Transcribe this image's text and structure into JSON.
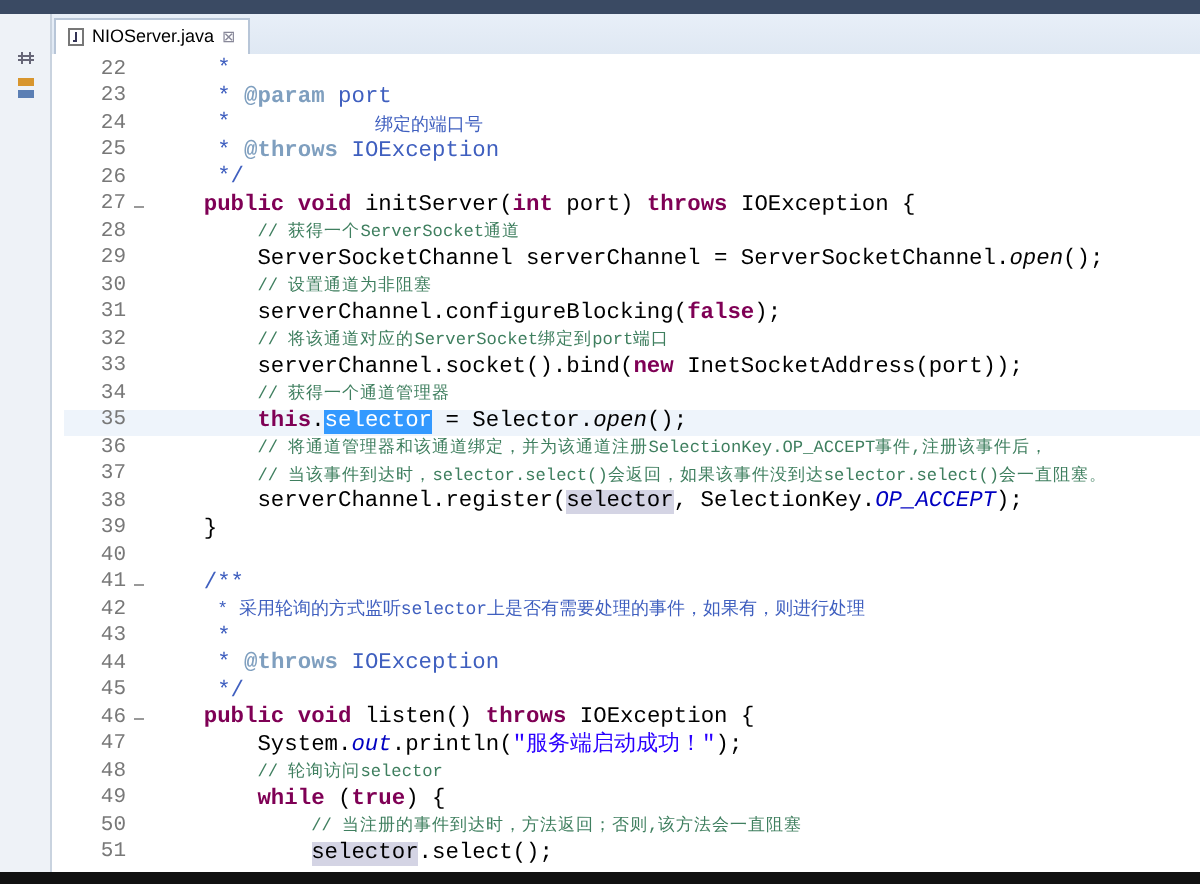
{
  "tabs": [
    {
      "label": "NIOServer.java",
      "selected": true,
      "close": "⊠"
    }
  ],
  "lines": [
    {
      "number": "22",
      "tokens": [
        {
          "kind": "doc",
          "text": "     *"
        }
      ]
    },
    {
      "number": "23",
      "tokens": [
        {
          "kind": "doc",
          "text": "     * "
        },
        {
          "kind": "doctag",
          "text": "@param"
        },
        {
          "kind": "doc",
          "text": " port"
        }
      ]
    },
    {
      "number": "24",
      "tokens": [
        {
          "kind": "doc",
          "text": "     *"
        }
      ],
      "note": "绑定的端口号"
    },
    {
      "number": "25",
      "tokens": [
        {
          "kind": "doc",
          "text": "     * "
        },
        {
          "kind": "doctag",
          "text": "@throws"
        },
        {
          "kind": "doc",
          "text": " IOException"
        }
      ]
    },
    {
      "number": "26",
      "tokens": [
        {
          "kind": "doc",
          "text": "     */"
        }
      ]
    },
    {
      "number": "27",
      "fold": true,
      "tokens": [
        {
          "kind": "keyword",
          "text": "    public void"
        },
        {
          "kind": "plain",
          "text": " initServer("
        },
        {
          "kind": "keyword",
          "text": "int"
        },
        {
          "kind": "plain",
          "text": " port) "
        },
        {
          "kind": "keyword",
          "text": "throws"
        },
        {
          "kind": "plain",
          "text": " IOException {"
        }
      ]
    },
    {
      "number": "28",
      "tokens": [
        {
          "kind": "comment",
          "text": "        // 获得一个ServerSocket通道"
        }
      ]
    },
    {
      "number": "29",
      "tokens": [
        {
          "kind": "plain",
          "text": "        ServerSocketChannel serverChannel = ServerSocketChannel."
        },
        {
          "kind": "italic",
          "text": "open"
        },
        {
          "kind": "plain",
          "text": "();"
        }
      ]
    },
    {
      "number": "30",
      "tokens": [
        {
          "kind": "comment",
          "text": "        // 设置通道为非阻塞"
        }
      ]
    },
    {
      "number": "31",
      "tokens": [
        {
          "kind": "plain",
          "text": "        serverChannel.configureBlocking("
        },
        {
          "kind": "keyword",
          "text": "false"
        },
        {
          "kind": "plain",
          "text": ");"
        }
      ]
    },
    {
      "number": "32",
      "tokens": [
        {
          "kind": "comment",
          "text": "        // 将该通道对应的ServerSocket绑定到port端口"
        }
      ]
    },
    {
      "number": "33",
      "tokens": [
        {
          "kind": "plain",
          "text": "        serverChannel.socket().bind("
        },
        {
          "kind": "keyword",
          "text": "new"
        },
        {
          "kind": "plain",
          "text": " InetSocketAddress(port));"
        }
      ]
    },
    {
      "number": "34",
      "tokens": [
        {
          "kind": "comment",
          "text": "        // 获得一个通道管理器"
        }
      ]
    },
    {
      "number": "35",
      "current": true,
      "tokens": [
        {
          "kind": "keyword",
          "text": "        this"
        },
        {
          "kind": "plain",
          "text": "."
        },
        {
          "kind": "selection",
          "text": "selector"
        },
        {
          "kind": "plain",
          "text": " = Selector."
        },
        {
          "kind": "italic",
          "text": "open"
        },
        {
          "kind": "plain",
          "text": "();"
        }
      ]
    },
    {
      "number": "36",
      "tokens": [
        {
          "kind": "comment",
          "text": "        // 将通道管理器和该通道绑定，并为该通道注册SelectionKey.OP_ACCEPT事件,注册该事件后，"
        }
      ]
    },
    {
      "number": "37",
      "tokens": [
        {
          "kind": "comment",
          "text": "        // 当该事件到达时，selector.select()会返回，如果该事件没到达selector.select()会一直阻塞。"
        }
      ]
    },
    {
      "number": "38",
      "tokens": [
        {
          "kind": "plain",
          "text": "        serverChannel.register("
        },
        {
          "kind": "occurrence",
          "text": "selector"
        },
        {
          "kind": "plain",
          "text": ", SelectionKey."
        },
        {
          "kind": "constant",
          "text": "OP_ACCEPT"
        },
        {
          "kind": "plain",
          "text": ");"
        }
      ]
    },
    {
      "number": "39",
      "tokens": [
        {
          "kind": "plain",
          "text": "    }"
        }
      ]
    },
    {
      "number": "40"
    },
    {
      "number": "41",
      "fold": true,
      "tokens": [
        {
          "kind": "doc",
          "text": "    /**"
        }
      ]
    },
    {
      "number": "42",
      "tokens": [
        {
          "kind": "docnote",
          "text": "     * 采用轮询的方式监听selector上是否有需要处理的事件，如果有，则进行处理"
        }
      ]
    },
    {
      "number": "43",
      "tokens": [
        {
          "kind": "doc",
          "text": "     *"
        }
      ]
    },
    {
      "number": "44",
      "tokens": [
        {
          "kind": "doc",
          "text": "     * "
        },
        {
          "kind": "doctag",
          "text": "@throws"
        },
        {
          "kind": "doc",
          "text": " IOException"
        }
      ]
    },
    {
      "number": "45",
      "tokens": [
        {
          "kind": "doc",
          "text": "     */"
        }
      ]
    },
    {
      "number": "46",
      "fold": true,
      "tokens": [
        {
          "kind": "keyword",
          "text": "    public void"
        },
        {
          "kind": "plain",
          "text": " listen() "
        },
        {
          "kind": "keyword",
          "text": "throws"
        },
        {
          "kind": "plain",
          "text": " IOException {"
        }
      ]
    },
    {
      "number": "47",
      "tokens": [
        {
          "kind": "plain",
          "text": "        System."
        },
        {
          "kind": "constant",
          "text": "out"
        },
        {
          "kind": "plain",
          "text": ".println("
        },
        {
          "kind": "string",
          "text": "\"服务端启动成功！\""
        },
        {
          "kind": "plain",
          "text": ");"
        }
      ]
    },
    {
      "number": "48",
      "tokens": [
        {
          "kind": "comment",
          "text": "        // 轮询访问selector"
        }
      ]
    },
    {
      "number": "49",
      "tokens": [
        {
          "kind": "keyword",
          "text": "        while"
        },
        {
          "kind": "plain",
          "text": " ("
        },
        {
          "kind": "keyword",
          "text": "true"
        },
        {
          "kind": "plain",
          "text": ") {"
        }
      ]
    },
    {
      "number": "50",
      "tokens": [
        {
          "kind": "comment",
          "text": "            // 当注册的事件到达时，方法返回；否则,该方法会一直阻塞"
        }
      ]
    },
    {
      "number": "51",
      "tokens": [
        {
          "kind": "occurrence",
          "text": "            selector"
        },
        {
          "kind": "plain",
          "text": ".select();"
        }
      ]
    }
  ]
}
